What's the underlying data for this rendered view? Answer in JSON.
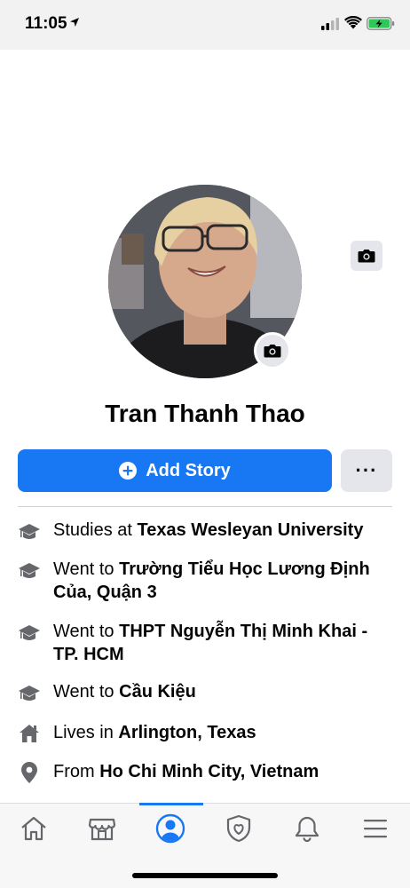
{
  "status_bar": {
    "time": "11:05"
  },
  "profile": {
    "name": "Tran Thanh Thao",
    "add_story_label": "Add Story",
    "more_label": "···"
  },
  "details": [
    {
      "icon": "graduation-cap-icon",
      "prefix": "Studies at ",
      "value": "Texas Wesleyan University"
    },
    {
      "icon": "graduation-cap-icon",
      "prefix": "Went to ",
      "value": "Trường Tiểu Học Lương Định Của, Quận 3"
    },
    {
      "icon": "graduation-cap-icon",
      "prefix": "Went to ",
      "value": "THPT Nguyễn Thị Minh Khai - TP. HCM"
    },
    {
      "icon": "graduation-cap-icon",
      "prefix": "Went to ",
      "value": "Cầu Kiệu"
    },
    {
      "icon": "home-icon",
      "prefix": "Lives in ",
      "value": "Arlington, Texas"
    },
    {
      "icon": "location-pin-icon",
      "prefix": "From ",
      "value": "Ho Chi Minh City, Vietnam"
    }
  ],
  "tab_bar": {
    "tabs": [
      {
        "name": "home-tab-icon",
        "active": false
      },
      {
        "name": "marketplace-tab-icon",
        "active": false
      },
      {
        "name": "profile-tab-icon",
        "active": true
      },
      {
        "name": "dating-tab-icon",
        "active": false
      },
      {
        "name": "notifications-tab-icon",
        "active": false
      },
      {
        "name": "menu-tab-icon",
        "active": false
      }
    ]
  },
  "colors": {
    "accent": "#1877f2",
    "button_gray": "#e4e6eb",
    "icon_gray": "#65676b"
  }
}
